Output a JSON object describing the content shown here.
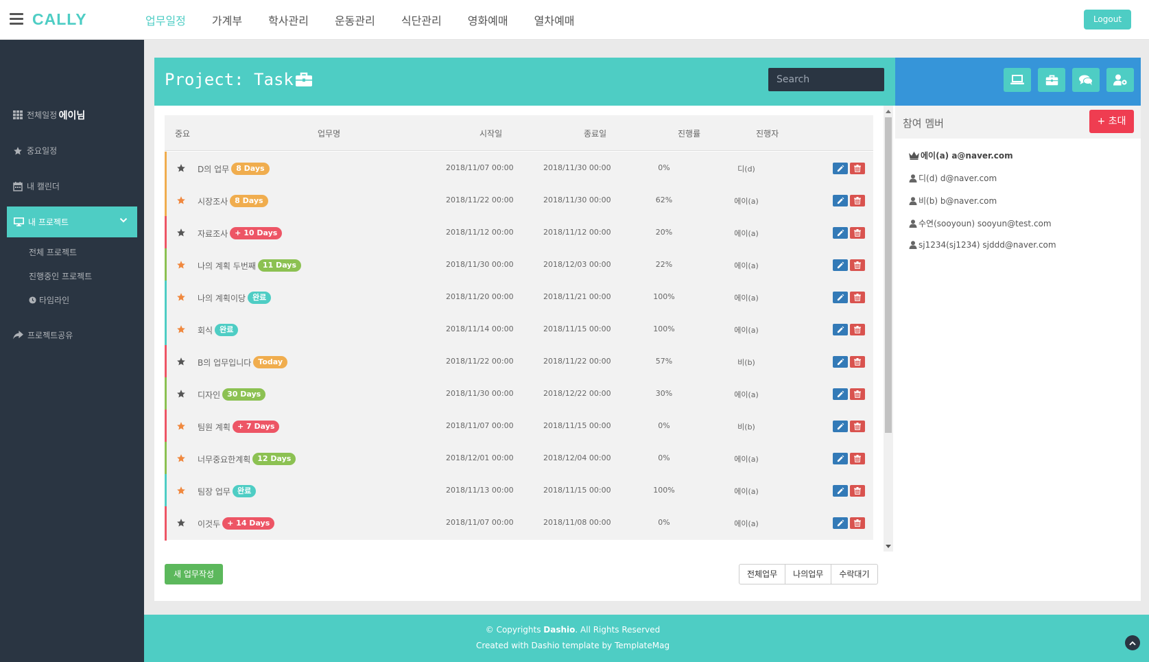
{
  "header": {
    "logo": "CALLY",
    "nav": [
      "업무일정",
      "가계부",
      "학사관리",
      "운동관리",
      "식단관리",
      "영화예매",
      "열차예매"
    ],
    "logout_label": "Logout"
  },
  "sidebar": {
    "profile_name": "에이님",
    "items": [
      {
        "label": "전체일정",
        "icon": "grid-icon"
      },
      {
        "label": "중요일정",
        "icon": "star-icon"
      },
      {
        "label": "내 캘린더",
        "icon": "calendar-icon"
      },
      {
        "label": "내 프로젝트",
        "icon": "desktop-icon"
      },
      {
        "label": "프로젝트공유",
        "icon": "share-icon"
      }
    ],
    "sub_items": [
      "전체 프로젝트",
      "진행중인 프로젝트",
      "타임라인"
    ]
  },
  "project": {
    "title": "Project: Task",
    "search_placeholder": "Search"
  },
  "table": {
    "columns": [
      "중요",
      "업무명",
      "시작일",
      "종료일",
      "진행률",
      "진행자"
    ],
    "rows": [
      {
        "name": "D의 업무",
        "badge": "8 Days",
        "badge_color": "#f0ad4e",
        "bar_color": "#f0ad4e",
        "starred": false,
        "start": "2018/11/07 00:00",
        "end": "2018/11/30 00:00",
        "progress": "0%",
        "assignee": "디(d)"
      },
      {
        "name": "시장조사",
        "badge": "8 Days",
        "badge_color": "#f0ad4e",
        "bar_color": "#f0ad4e",
        "starred": true,
        "start": "2018/11/22 00:00",
        "end": "2018/11/30 00:00",
        "progress": "62%",
        "assignee": "에이(a)"
      },
      {
        "name": "자료조사",
        "badge": "+ 10 Days",
        "badge_color": "#ed5565",
        "bar_color": "#ed5565",
        "starred": false,
        "start": "2018/11/12 00:00",
        "end": "2018/11/12 00:00",
        "progress": "20%",
        "assignee": "에이(a)"
      },
      {
        "name": "나의 계획 두번째",
        "badge": "11 Days",
        "badge_color": "#8cc152",
        "bar_color": "#8cc152",
        "starred": true,
        "start": "2018/11/30 00:00",
        "end": "2018/12/03 00:00",
        "progress": "22%",
        "assignee": "에이(a)"
      },
      {
        "name": "나의 계획이당",
        "badge": "완료",
        "badge_color": "#4ecdc4",
        "bar_color": "#4ecdc4",
        "starred": true,
        "start": "2018/11/20 00:00",
        "end": "2018/11/21 00:00",
        "progress": "100%",
        "assignee": "에이(a)"
      },
      {
        "name": "회식",
        "badge": "완료",
        "badge_color": "#4ecdc4",
        "bar_color": "#4ecdc4",
        "starred": true,
        "start": "2018/11/14 00:00",
        "end": "2018/11/15 00:00",
        "progress": "100%",
        "assignee": "에이(a)"
      },
      {
        "name": "B의 업무입니다",
        "badge": "Today",
        "badge_color": "#f0ad4e",
        "bar_color": "#ed5565",
        "starred": false,
        "start": "2018/11/22 00:00",
        "end": "2018/11/22 00:00",
        "progress": "57%",
        "assignee": "비(b)"
      },
      {
        "name": "디자인",
        "badge": "30 Days",
        "badge_color": "#8cc152",
        "bar_color": "#8cc152",
        "starred": false,
        "start": "2018/11/30 00:00",
        "end": "2018/12/22 00:00",
        "progress": "30%",
        "assignee": "에이(a)"
      },
      {
        "name": "팀원 계획",
        "badge": "+ 7 Days",
        "badge_color": "#ed5565",
        "bar_color": "#ed5565",
        "starred": true,
        "start": "2018/11/07 00:00",
        "end": "2018/11/15 00:00",
        "progress": "0%",
        "assignee": "비(b)"
      },
      {
        "name": "너무중요한계획",
        "badge": "12 Days",
        "badge_color": "#8cc152",
        "bar_color": "#8cc152",
        "starred": true,
        "start": "2018/12/01 00:00",
        "end": "2018/12/04 00:00",
        "progress": "0%",
        "assignee": "에이(a)"
      },
      {
        "name": "팀장 업무",
        "badge": "완료",
        "badge_color": "#4ecdc4",
        "bar_color": "#4ecdc4",
        "starred": true,
        "start": "2018/11/13 00:00",
        "end": "2018/11/15 00:00",
        "progress": "100%",
        "assignee": "에이(a)"
      },
      {
        "name": "이것두",
        "badge": "+ 14 Days",
        "badge_color": "#ed5565",
        "bar_color": "#ed5565",
        "starred": false,
        "start": "2018/11/07 00:00",
        "end": "2018/11/08 00:00",
        "progress": "0%",
        "assignee": "에이(a)"
      }
    ]
  },
  "actions": {
    "new_task": "새 업무작성",
    "filters": [
      "전체업무",
      "나의업무",
      "수락대기"
    ]
  },
  "members": {
    "title": "참여 멤버",
    "invite_label": "+ 초대",
    "list": [
      {
        "label": "에이(a) a@naver.com",
        "owner": true
      },
      {
        "label": "디(d) d@naver.com",
        "owner": false
      },
      {
        "label": "비(b) b@naver.com",
        "owner": false
      },
      {
        "label": "수연(sooyoun) sooyun@test.com",
        "owner": false
      },
      {
        "label": "sj1234(sj1234) sjddd@naver.com",
        "owner": false
      }
    ],
    "toolbar_icons": [
      "laptop-icon",
      "briefcase-icon",
      "comments-icon",
      "user-settings-icon"
    ]
  },
  "footer": {
    "copyright_prefix": "© Copyrights ",
    "brand": "Dashio",
    "copyright_suffix": ". All Rights Reserved",
    "credit": "Created with Dashio template by TemplateMag"
  },
  "colors": {
    "accent": "#4ecdc4",
    "sidebar_bg": "#2a3542",
    "members_header": "#3695d9",
    "danger": "#ef3d51",
    "success": "#5cb85c"
  }
}
